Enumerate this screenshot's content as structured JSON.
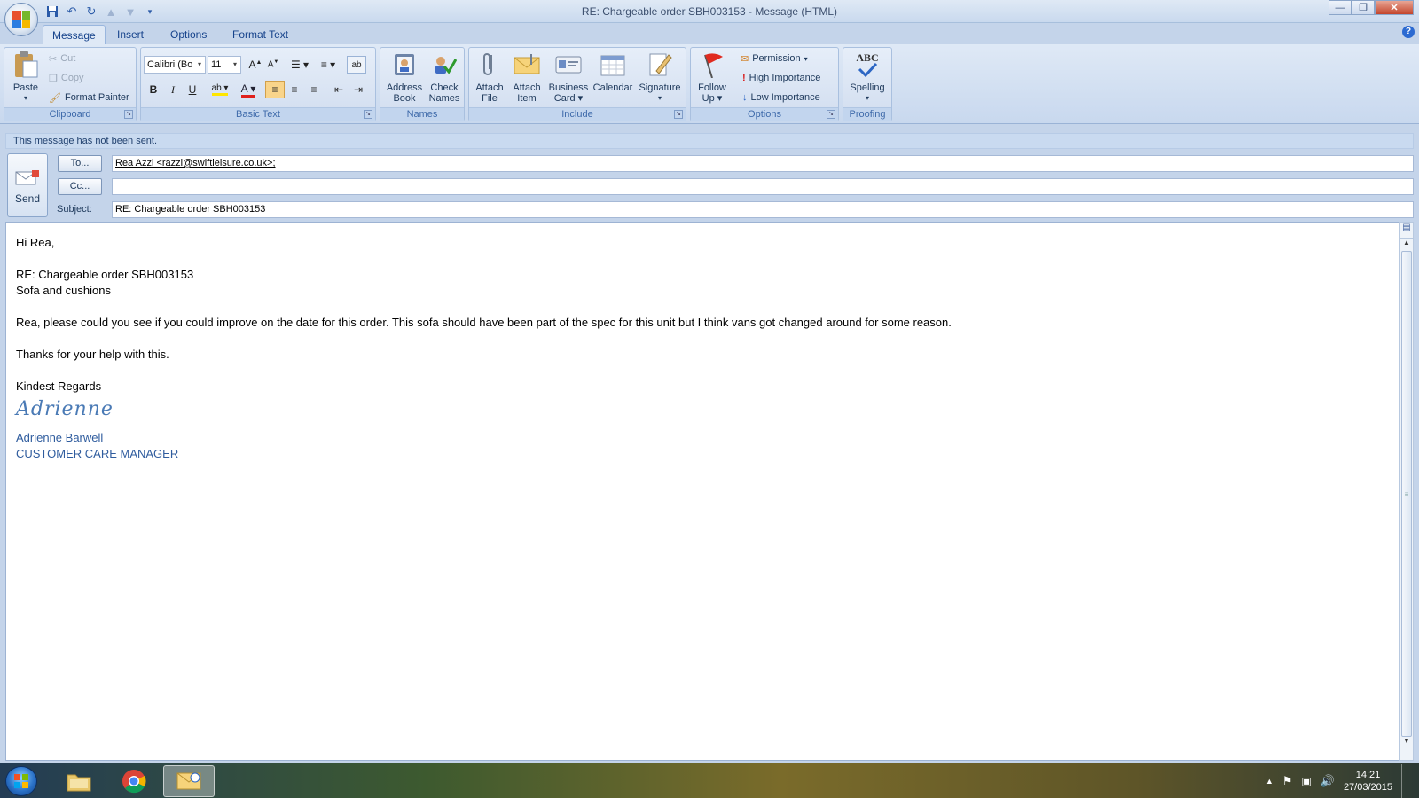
{
  "window": {
    "title": "RE: Chargeable order SBH003153 - Message (HTML)"
  },
  "tabs": [
    {
      "label": "Message",
      "active": true
    },
    {
      "label": "Insert",
      "active": false
    },
    {
      "label": "Options",
      "active": false
    },
    {
      "label": "Format Text",
      "active": false
    }
  ],
  "ribbon": {
    "clipboard": {
      "label": "Clipboard",
      "paste": "Paste",
      "cut": "Cut",
      "copy": "Copy",
      "format_painter": "Format Painter"
    },
    "basic_text": {
      "label": "Basic Text",
      "font": "Calibri (Bo",
      "size": "11",
      "bold": "B",
      "italic": "I",
      "underline": "U"
    },
    "names": {
      "label": "Names",
      "address_book_1": "Address",
      "address_book_2": "Book",
      "check_names_1": "Check",
      "check_names_2": "Names"
    },
    "include": {
      "label": "Include",
      "attach_file_1": "Attach",
      "attach_file_2": "File",
      "attach_item_1": "Attach",
      "attach_item_2": "Item",
      "business_card_1": "Business",
      "business_card_2": "Card",
      "calendar": "Calendar",
      "signature": "Signature"
    },
    "options": {
      "label": "Options",
      "follow_up_1": "Follow",
      "follow_up_2": "Up",
      "permission": "Permission",
      "high_importance": "High Importance",
      "low_importance": "Low Importance"
    },
    "proofing": {
      "label": "Proofing",
      "abc": "ABC",
      "spelling": "Spelling"
    }
  },
  "infobar": "This message has not been sent.",
  "header": {
    "send": "Send",
    "to_button": "To...",
    "cc_button": "Cc...",
    "subject_label": "Subject:",
    "to_value": "Rea Azzi <razzi@swiftleisure.co.uk>;",
    "cc_value": "",
    "subject_value": "RE: Chargeable order SBH003153"
  },
  "body": {
    "greeting": "Hi Rea,",
    "ref_line": "RE: Chargeable order SBH003153",
    "item_line": "Sofa and cushions",
    "paragraph": "Rea, please could you see if you could improve on the date for this order.  This sofa should have been part of the spec for this unit but I think vans got changed around  for some reason.",
    "thanks": "Thanks for your help with this.",
    "closing": "Kindest Regards",
    "signature_script": "Adrienne",
    "sig_name": "Adrienne Barwell",
    "sig_title": "CUSTOMER CARE MANAGER"
  },
  "taskbar": {
    "time": "14:21",
    "date": "27/03/2015"
  },
  "colors": {
    "accent": "#15428b",
    "ribbon": "#dfe9f6",
    "signature": "#2f5c9e"
  }
}
